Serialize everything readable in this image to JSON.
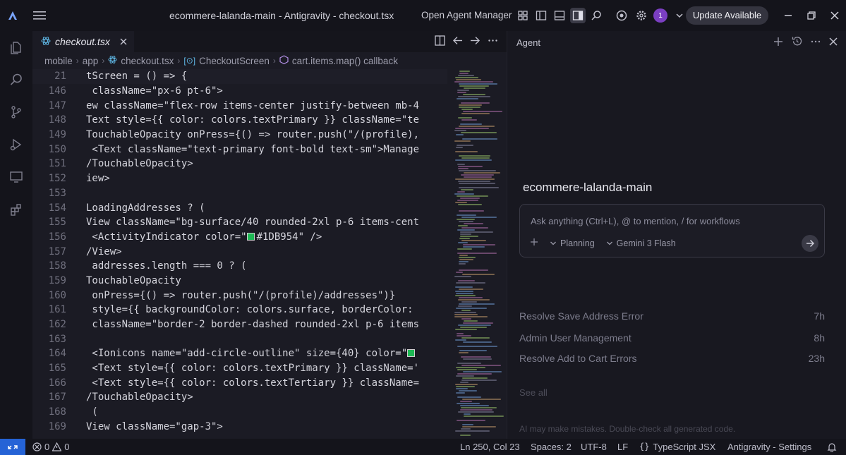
{
  "titlebar": {
    "window_title": "ecommere-lalanda-main - Antigravity - checkout.tsx",
    "agent_manager": "Open Agent Manager",
    "avatar_count": "1",
    "update_label": "Update Available"
  },
  "editor": {
    "tab_label": "checkout.tsx",
    "breadcrumb": [
      "mobile",
      "app",
      "checkout.tsx",
      "CheckoutScreen",
      "cart.items.map() callback"
    ],
    "lines": [
      {
        "n": "21",
        "code": "tScreen = () => {",
        "sticky": true
      },
      {
        "n": "146",
        "code": " className=\"px-6 pt-6\">"
      },
      {
        "n": "147",
        "code": "ew className=\"flex-row items-center justify-between mb-4"
      },
      {
        "n": "148",
        "code": "Text style={{ color: colors.textPrimary }} className=\"te"
      },
      {
        "n": "149",
        "code": "TouchableOpacity onPress={() => router.push(\"/(profile),"
      },
      {
        "n": "150",
        "code": " <Text className=\"text-primary font-bold text-sm\">Manage"
      },
      {
        "n": "151",
        "code": "/TouchableOpacity>"
      },
      {
        "n": "152",
        "code": "iew>"
      },
      {
        "n": "153",
        "code": ""
      },
      {
        "n": "154",
        "code": "LoadingAddresses ? ("
      },
      {
        "n": "155",
        "code": "View className=\"bg-surface/40 rounded-2xl p-6 items-cent"
      },
      {
        "n": "156",
        "code_pre": " <ActivityIndicator color=\"",
        "code_post": "#1DB954\" />",
        "swatch": true
      },
      {
        "n": "157",
        "code": "/View>"
      },
      {
        "n": "158",
        "code": " addresses.length === 0 ? ("
      },
      {
        "n": "159",
        "code": "TouchableOpacity"
      },
      {
        "n": "160",
        "code": " onPress={() => router.push(\"/(profile)/addresses\")}"
      },
      {
        "n": "161",
        "code": " style={{ backgroundColor: colors.surface, borderColor:"
      },
      {
        "n": "162",
        "code": " className=\"border-2 border-dashed rounded-2xl p-6 items"
      },
      {
        "n": "163",
        "code": ""
      },
      {
        "n": "164",
        "code_pre": " <Ionicons name=\"add-circle-outline\" size={40} color=\"",
        "code_post": "",
        "swatch": true
      },
      {
        "n": "165",
        "code": " <Text style={{ color: colors.textPrimary }} className='"
      },
      {
        "n": "166",
        "code": " <Text style={{ color: colors.textTertiary }} className="
      },
      {
        "n": "167",
        "code": "/TouchableOpacity>"
      },
      {
        "n": "168",
        "code": " ("
      },
      {
        "n": "169",
        "code": "View className=\"gap-3\">"
      }
    ]
  },
  "agent": {
    "header": "Agent",
    "project_title": "ecommere-lalanda-main",
    "placeholder": "Ask anything (Ctrl+L), @ to mention, / for workflows",
    "mode": "Planning",
    "model": "Gemini 3 Flash",
    "recent": [
      {
        "title": "Resolve Save Address Error",
        "time": "7h"
      },
      {
        "title": "Admin User Management",
        "time": "8h"
      },
      {
        "title": "Resolve Add to Cart Errors",
        "time": "23h"
      }
    ],
    "see_all": "See all",
    "disclaimer": "AI may make mistakes. Double-check all generated code."
  },
  "statusbar": {
    "errors": "0",
    "warnings": "0",
    "position": "Ln 250, Col 23",
    "spaces": "Spaces: 2",
    "encoding": "UTF-8",
    "eol": "LF",
    "language": "TypeScript JSX",
    "settings": "Antigravity - Settings"
  },
  "colors": {
    "swatch": "#1DB954",
    "remote": "#2563d6",
    "avatar": "#7b3fc2"
  }
}
